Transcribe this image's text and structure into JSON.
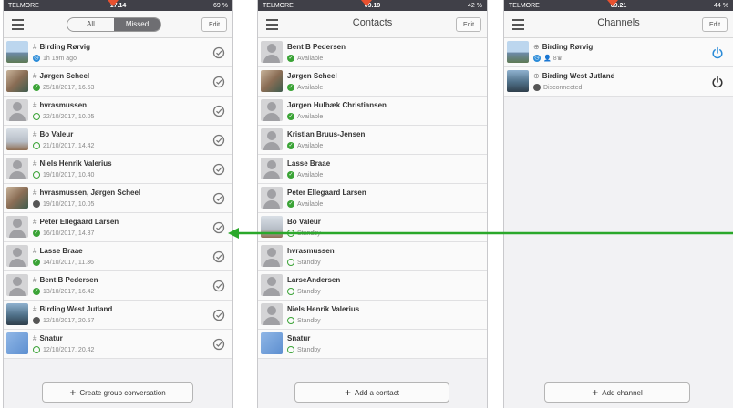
{
  "markers_color": "#e8512f",
  "arrow_color": "#2aa82a",
  "screen1": {
    "status": {
      "carrier": "TELMORE",
      "time": "17.14",
      "battery": "69 %"
    },
    "segment": {
      "all": "All",
      "missed": "Missed"
    },
    "edit": "Edit",
    "rows": [
      {
        "name": "Birding Rørvig",
        "sub": "1h 19m ago",
        "avatar": "land",
        "status": "blue"
      },
      {
        "name": "Jørgen Scheel",
        "sub": "25/10/2017, 16.53",
        "avatar": "photo",
        "status": "green"
      },
      {
        "name": "hvrasmussen",
        "sub": "22/10/2017, 10.05",
        "avatar": "default",
        "status": "ring"
      },
      {
        "name": "Bo Valeur",
        "sub": "21/10/2017, 14.42",
        "avatar": "boat",
        "status": "ring"
      },
      {
        "name": "Niels Henrik Valerius",
        "sub": "19/10/2017, 10.40",
        "avatar": "default",
        "status": "ring"
      },
      {
        "name": "hvrasmussen, Jørgen Scheel",
        "sub": "19/10/2017, 10.05",
        "avatar": "photo",
        "status": "gray"
      },
      {
        "name": "Peter Ellegaard Larsen",
        "sub": "16/10/2017, 14.37",
        "avatar": "default",
        "status": "green"
      },
      {
        "name": "Lasse Braae",
        "sub": "14/10/2017, 11.36",
        "avatar": "default",
        "status": "green"
      },
      {
        "name": "Bent B Pedersen",
        "sub": "13/10/2017, 16.42",
        "avatar": "default",
        "status": "green"
      },
      {
        "name": "Birding West Jutland",
        "sub": "12/10/2017, 20.57",
        "avatar": "sea",
        "status": "gray"
      },
      {
        "name": "Snatur",
        "sub": "12/10/2017, 20.42",
        "avatar": "blue",
        "status": "ring"
      }
    ],
    "bottom_button": "Create group conversation"
  },
  "screen2": {
    "status": {
      "carrier": "TELMORE",
      "time": "09.19",
      "battery": "42 %"
    },
    "title": "Contacts",
    "edit": "Edit",
    "rows": [
      {
        "name": "Bent B Pedersen",
        "sub": "Available",
        "avatar": "default",
        "status": "green"
      },
      {
        "name": "Jørgen Scheel",
        "sub": "Available",
        "avatar": "photo",
        "status": "green"
      },
      {
        "name": "Jørgen Hulbæk Christiansen",
        "sub": "Available",
        "avatar": "default",
        "status": "green"
      },
      {
        "name": "Kristian Bruus-Jensen",
        "sub": "Available",
        "avatar": "default",
        "status": "green"
      },
      {
        "name": "Lasse Braae",
        "sub": "Available",
        "avatar": "default",
        "status": "green"
      },
      {
        "name": "Peter Ellegaard Larsen",
        "sub": "Available",
        "avatar": "default",
        "status": "green"
      },
      {
        "name": "Bo Valeur",
        "sub": "Standby",
        "avatar": "boat",
        "status": "ring"
      },
      {
        "name": "hvrasmussen",
        "sub": "Standby",
        "avatar": "default",
        "status": "ring"
      },
      {
        "name": "LarseAndersen",
        "sub": "Standby",
        "avatar": "default",
        "status": "ring"
      },
      {
        "name": "Niels Henrik Valerius",
        "sub": "Standby",
        "avatar": "default",
        "status": "ring"
      },
      {
        "name": "Snatur",
        "sub": "Standby",
        "avatar": "blue",
        "status": "ring"
      }
    ],
    "bottom_button": "Add a contact"
  },
  "screen3": {
    "status": {
      "carrier": "TELMORE",
      "time": "09.21",
      "battery": "44 %"
    },
    "title": "Channels",
    "edit": "Edit",
    "rows": [
      {
        "name": "Birding Rørvig",
        "sub": "8",
        "avatar": "land",
        "power_color": "#2a8bd8"
      },
      {
        "name": "Birding West Jutland",
        "sub": "Disconnected",
        "avatar": "sea",
        "power_color": "#333333"
      }
    ],
    "bottom_button": "Add channel"
  }
}
